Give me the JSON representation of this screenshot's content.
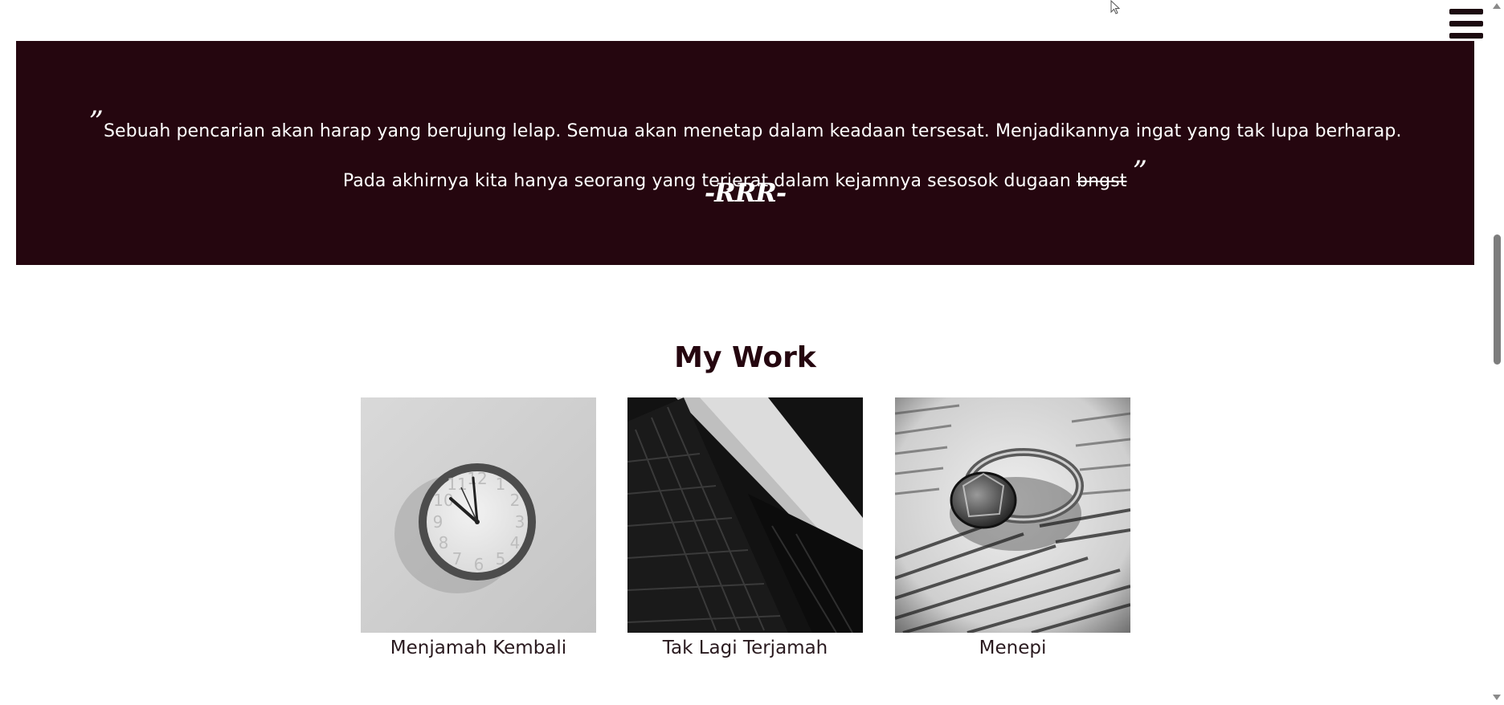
{
  "quote": {
    "open_mark": "”",
    "line_part1": "Sebuah pencarian akan harap yang berujung lelap. Semua akan menetap dalam keadaan tersesat. Menjadikannya ingat yang tak lupa berharap. Pada akhirnya kita hanya seorang yang terjerat dalam kejamnya sesosok dugaan",
    "struck_word": "bngst",
    "close_mark": "”",
    "author": "-RRR-"
  },
  "work": {
    "title": "My Work",
    "items": [
      {
        "caption": "Menjamah Kembali",
        "image": "wall-clock-photo"
      },
      {
        "caption": "Tak Lagi Terjamah",
        "image": "building-photo"
      },
      {
        "caption": "Menepi",
        "image": "ring-on-book-photo"
      }
    ]
  },
  "menu": {
    "icon": "hamburger-menu-icon"
  },
  "colors": {
    "banner_bg": "#25060f",
    "title": "#25060f"
  }
}
